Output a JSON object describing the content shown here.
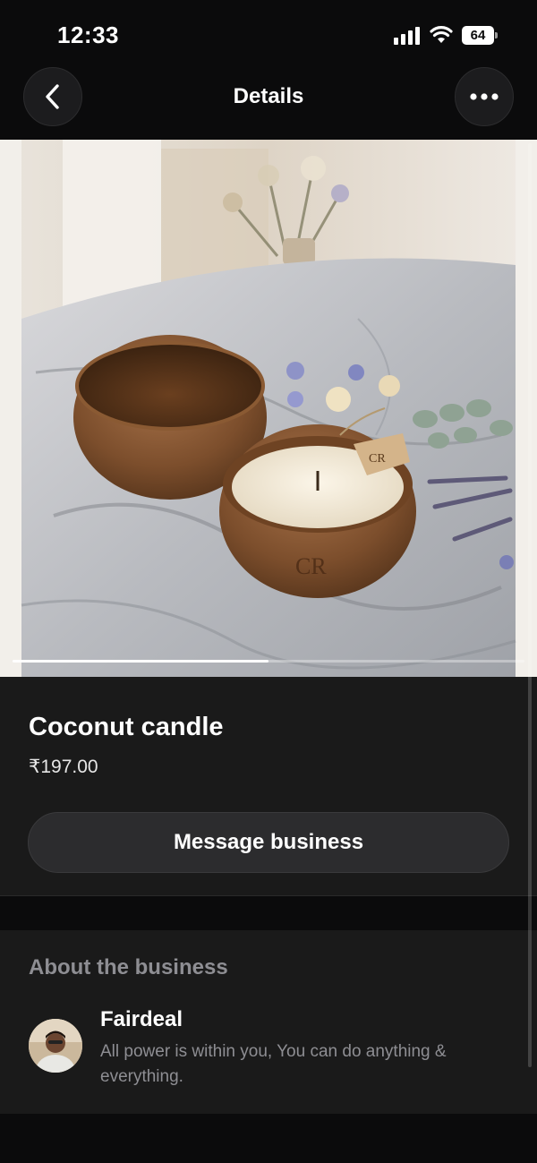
{
  "status_bar": {
    "time": "12:33",
    "battery": "64"
  },
  "nav": {
    "title": "Details",
    "back_icon": "chevron-left-icon",
    "more_icon": "more-horizontal-icon"
  },
  "product": {
    "image": "coconut-shell-candles-photo",
    "image_progress": 0.5,
    "title": "Coconut candle",
    "price": "₹197.00",
    "message_button": "Message business"
  },
  "about": {
    "heading": "About the business",
    "business_name": "Fairdeal",
    "description": "All power is within you, You can do anything & everything."
  },
  "colors": {
    "background": "#0b0b0c",
    "card": "#1a1a1a",
    "button": "#2c2c2e",
    "secondary_text": "#8e8e93"
  }
}
